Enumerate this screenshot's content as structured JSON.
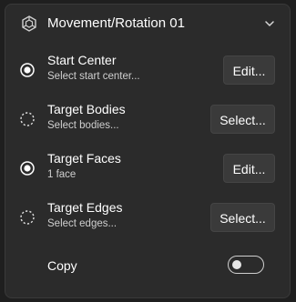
{
  "header": {
    "title": "Movement/Rotation 01",
    "icon": "move-rotate-icon",
    "collapse_icon": "chevron-down-icon"
  },
  "rows": [
    {
      "label": "Start Center",
      "sub": "Select start center...",
      "button": "Edit...",
      "selected": true
    },
    {
      "label": "Target Bodies",
      "sub": "Select bodies...",
      "button": "Select...",
      "selected": false
    },
    {
      "label": "Target Faces",
      "sub": "1 face",
      "button": "Edit...",
      "selected": true
    },
    {
      "label": "Target Edges",
      "sub": "Select edges...",
      "button": "Select...",
      "selected": false
    }
  ],
  "copy": {
    "label": "Copy",
    "enabled": false
  },
  "colors": {
    "panel_bg": "#2b2b2b",
    "text": "#ffffff",
    "subtext": "#cfcfcf",
    "button_bg": "#3a3a3a"
  }
}
